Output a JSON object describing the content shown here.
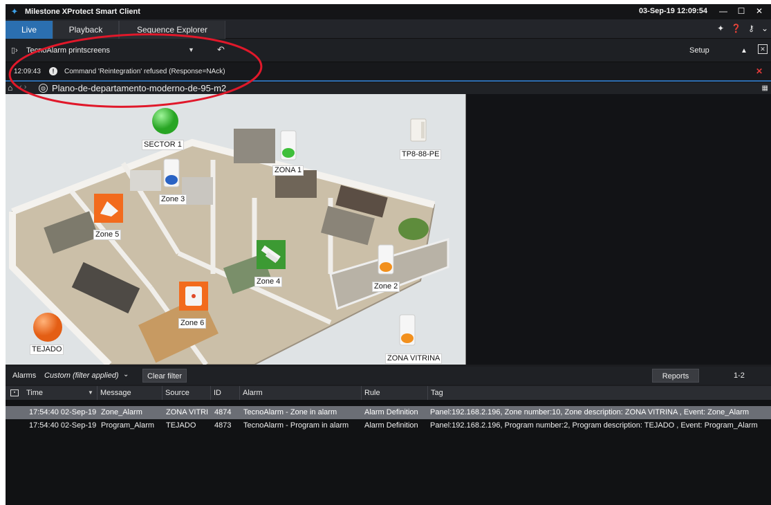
{
  "titlebar": {
    "app_title": "Milestone XProtect Smart Client",
    "clock": "03-Sep-19 12:09:54",
    "minimize": "—",
    "maximize": "☐",
    "close": "✕"
  },
  "tabs": [
    {
      "label": "Live",
      "active": true
    },
    {
      "label": "Playback",
      "active": false
    },
    {
      "label": "Sequence Explorer",
      "active": false
    }
  ],
  "top_icons": {
    "pin": "✦",
    "help": "❓",
    "key": "⚷",
    "menu": "⌄"
  },
  "viewbar": {
    "view_name": "TecnoAlarm printscreens",
    "setup_label": "Setup"
  },
  "notification": {
    "time": "12:09:43",
    "message": "Command 'Reintegration' refused (Response=NAck)"
  },
  "breadcrumb": {
    "map_title": "Plano-de-departamento-moderno-de-95-m2"
  },
  "map": {
    "labels": {
      "sector1": "SECTOR 1",
      "tp8": "TP8-88-PE",
      "zona1": "ZONA 1",
      "zone3": "Zone 3",
      "zone5": "Zone 5",
      "zone4": "Zone 4",
      "zone2": "Zone 2",
      "zone6": "Zone 6",
      "tejado": "TEJADO",
      "zona_vitrina": "ZONA VITRINA"
    },
    "colors": {
      "green": "#3fbf3a",
      "orange": "#f26b1d",
      "blue": "#2a63c4"
    }
  },
  "alarms": {
    "label": "Alarms",
    "filter": "Custom (filter applied)",
    "clear_filter": "Clear filter",
    "reports": "Reports",
    "range": "1-2",
    "columns": [
      "Time",
      "Message",
      "Source",
      "ID",
      "Alarm",
      "Rule",
      "Tag"
    ],
    "rows": [
      {
        "time": "17:54:40 02-Sep-19",
        "message": "Zone_Alarm",
        "source": "ZONA VITRI",
        "id": "4874",
        "alarm": "TecnoAlarm - Zone in alarm",
        "rule": "Alarm Definition",
        "tag": "Panel:192.168.2.196, Zone number:10, Zone description: ZONA VITRINA , Event: Zone_Alarm"
      },
      {
        "time": "17:54:40 02-Sep-19",
        "message": "Program_Alarm",
        "source": "TEJADO",
        "id": "4873",
        "alarm": "TecnoAlarm - Program in alarm",
        "rule": "Alarm Definition",
        "tag": "Panel:192.168.2.196, Program number:2, Program description: TEJADO , Event: Program_Alarm"
      }
    ]
  }
}
